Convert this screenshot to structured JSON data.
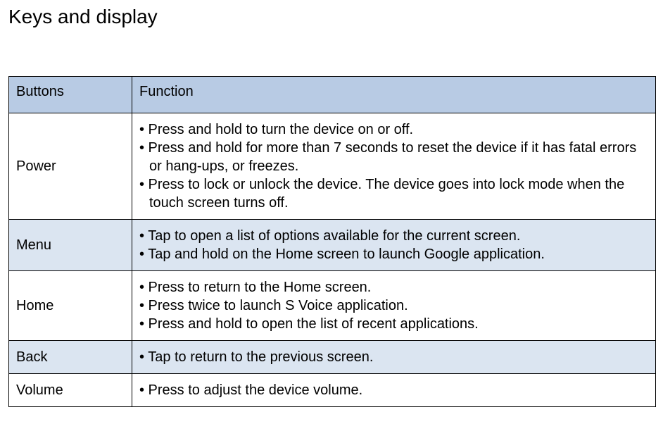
{
  "page_title": "Keys and display",
  "table": {
    "headers": {
      "buttons": "Buttons",
      "function": "Function"
    },
    "rows": [
      {
        "button": "Power",
        "functions": [
          "• Press and hold to turn the device on or off.",
          "• Press and hold for more than 7 seconds to reset the device if it has fatal errors or hang-ups, or freezes.",
          "• Press to lock or unlock the device. The device goes into lock mode when the touch screen turns off."
        ],
        "alt": false
      },
      {
        "button": "Menu",
        "functions": [
          "• Tap to open a list of options available for the current screen.",
          "• Tap and hold on the Home screen to launch Google application."
        ],
        "alt": true
      },
      {
        "button": "Home",
        "functions": [
          "• Press to return to the Home screen.",
          "• Press twice to launch S Voice application.",
          "• Press and hold to open the list of recent applications."
        ],
        "alt": false
      },
      {
        "button": "Back",
        "functions": [
          "• Tap to return to the previous screen."
        ],
        "alt": true
      },
      {
        "button": "Volume",
        "functions": [
          "• Press to adjust the device volume."
        ],
        "alt": false
      }
    ]
  }
}
